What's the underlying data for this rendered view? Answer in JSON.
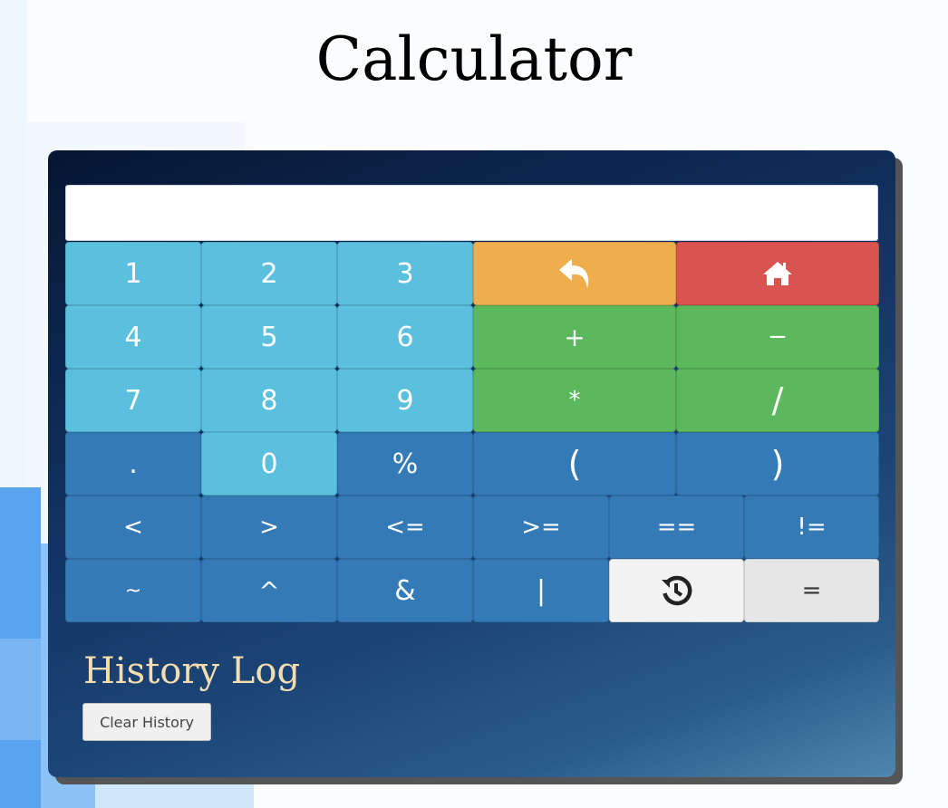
{
  "page": {
    "title": "Calculator"
  },
  "display": {
    "value": ""
  },
  "keys": {
    "one": "1",
    "two": "2",
    "three": "3",
    "four": "4",
    "five": "5",
    "six": "6",
    "seven": "7",
    "eight": "8",
    "nine": "9",
    "dot": ".",
    "zero": "0",
    "percent": "%",
    "plus": "+",
    "minus": "−",
    "multiply": "*",
    "divide": "/",
    "open_paren": "(",
    "close_paren": ")",
    "lt": "<",
    "gt": ">",
    "lte": "<=",
    "gte": ">=",
    "eq": "==",
    "neq": "!=",
    "tilde": "~",
    "xor": "^",
    "and": "&",
    "or": "|",
    "equals": "=",
    "backspace_icon": "undo-arrow-icon",
    "home_icon": "home-icon",
    "history_icon": "history-icon"
  },
  "history": {
    "title": "History Log",
    "clear_label": "Clear History"
  },
  "colors": {
    "digit": "#5bc0de",
    "operator_dark": "#337ab7",
    "arith": "#5cb85c",
    "back": "#f0ad4e",
    "home": "#d9534f",
    "history_title": "#f5ddb0"
  }
}
